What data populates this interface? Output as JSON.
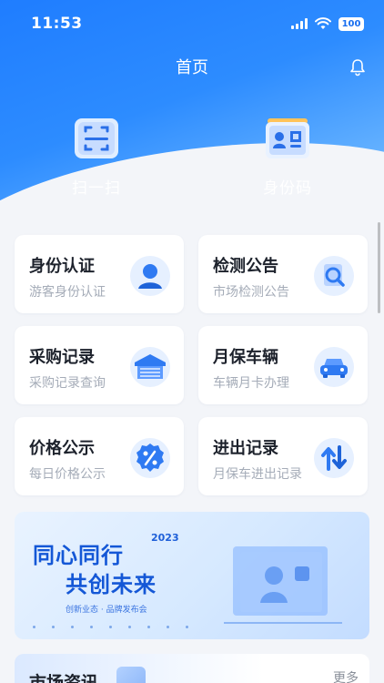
{
  "status": {
    "time": "11:53",
    "battery": "100"
  },
  "header": {
    "title": "首页"
  },
  "quick_actions": [
    {
      "label": "扫一扫",
      "icon": "scan-icon"
    },
    {
      "label": "身份码",
      "icon": "id-card-icon"
    }
  ],
  "cards": [
    {
      "title": "身份认证",
      "subtitle": "游客身份认证",
      "icon": "person-icon"
    },
    {
      "title": "检测公告",
      "subtitle": "市场检测公告",
      "icon": "magnifier-icon"
    },
    {
      "title": "采购记录",
      "subtitle": "采购记录查询",
      "icon": "warehouse-icon"
    },
    {
      "title": "月保车辆",
      "subtitle": "车辆月卡办理",
      "icon": "car-icon"
    },
    {
      "title": "价格公示",
      "subtitle": "每日价格公示",
      "icon": "percent-badge-icon"
    },
    {
      "title": "进出记录",
      "subtitle": "月保车进出记录",
      "icon": "up-down-arrows-icon"
    }
  ],
  "banner": {
    "line1": "同心同行",
    "line2": "共创未来",
    "year": "2023",
    "tagline": "创新业态 · 品牌发布会"
  },
  "news": {
    "title": "市场资讯",
    "more": "更多"
  },
  "colors": {
    "primary": "#1f7dff",
    "accent": "#ffb83a"
  }
}
